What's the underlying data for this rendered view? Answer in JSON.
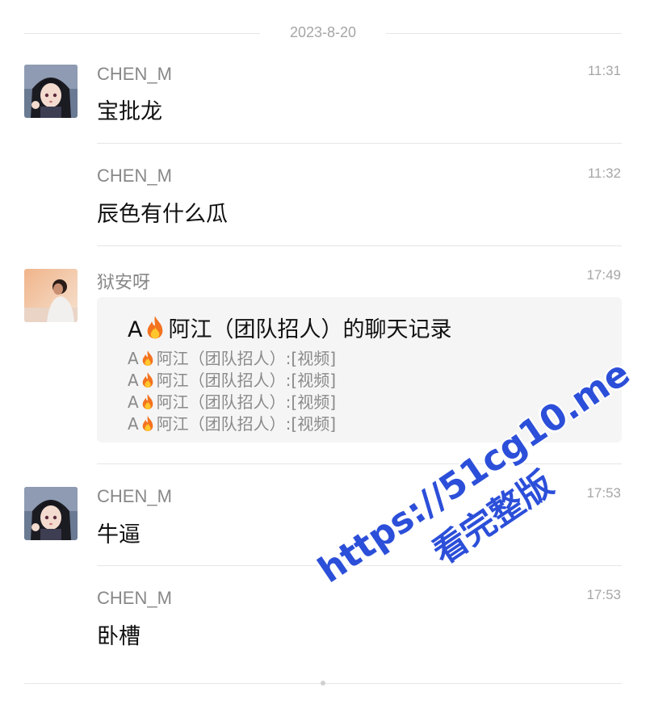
{
  "date_separator": "2023-8-20",
  "messages": [
    {
      "sender": "CHEN_M",
      "time": "11:31",
      "text": "宝批龙",
      "avatar": "anime-girl-avatar"
    },
    {
      "sender": "CHEN_M",
      "time": "11:32",
      "text": "辰色有什么瓜"
    },
    {
      "sender": "狱安呀",
      "time": "17:49",
      "avatar": "person-sunset-avatar",
      "record": {
        "title_prefix": "A",
        "title_suffix": "阿江（团队招人）的聊天记录",
        "lines": [
          {
            "prefix": "A",
            "suffix": "阿江（团队招人）:[视频]"
          },
          {
            "prefix": "A",
            "suffix": "阿江（团队招人）:[视频]"
          },
          {
            "prefix": "A",
            "suffix": "阿江（团队招人）:[视频]"
          },
          {
            "prefix": "A",
            "suffix": "阿江（团队招人）:[视频]"
          }
        ],
        "icon": "fire-emoji"
      }
    },
    {
      "sender": "CHEN_M",
      "time": "17:53",
      "text": "牛逼",
      "avatar": "anime-girl-avatar"
    },
    {
      "sender": "CHEN_M",
      "time": "17:53",
      "text": "卧槽"
    }
  ],
  "watermark": {
    "line1": "https://51cg10.me",
    "line2": "看完整版"
  },
  "colors": {
    "watermark": "#2c4fd9",
    "record_bg": "#f5f5f5",
    "meta_text": "#a6a6a6"
  }
}
